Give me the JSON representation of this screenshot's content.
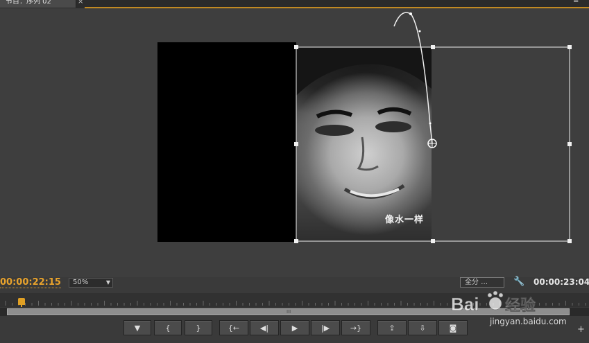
{
  "tab": {
    "label": "节目：序列 02",
    "close_symbol": "×",
    "menu_symbol": "≡"
  },
  "monitor": {
    "subtitle": "像水一样",
    "timecode_current": "00:00:22:15",
    "timecode_duration": "00:00:23:04",
    "zoom": "50%",
    "resolution": "全分 …"
  },
  "transport": {
    "buttons": [
      {
        "name": "marker-button",
        "symbol": "▼"
      },
      {
        "name": "mark-in-button",
        "symbol": "{"
      },
      {
        "name": "mark-out-button",
        "symbol": "}"
      },
      {
        "name": "go-to-in-button",
        "symbol": "{←"
      },
      {
        "name": "step-back-button",
        "symbol": "◀|"
      },
      {
        "name": "play-button",
        "symbol": "▶"
      },
      {
        "name": "step-forward-button",
        "symbol": "|▶"
      },
      {
        "name": "go-to-out-button",
        "symbol": "→}"
      },
      {
        "name": "lift-button",
        "symbol": "⇪"
      },
      {
        "name": "extract-button",
        "symbol": "⇩"
      },
      {
        "name": "export-frame-button",
        "symbol": "◙"
      }
    ],
    "add_symbol": "+"
  },
  "scrollbar": {
    "grip": "III"
  },
  "watermark": {
    "brand": "Bai",
    "brand2": "经验",
    "url": "jingyan.baidu.com"
  },
  "colors": {
    "accent": "#e9a32c",
    "panel": "#3e3e3e"
  }
}
